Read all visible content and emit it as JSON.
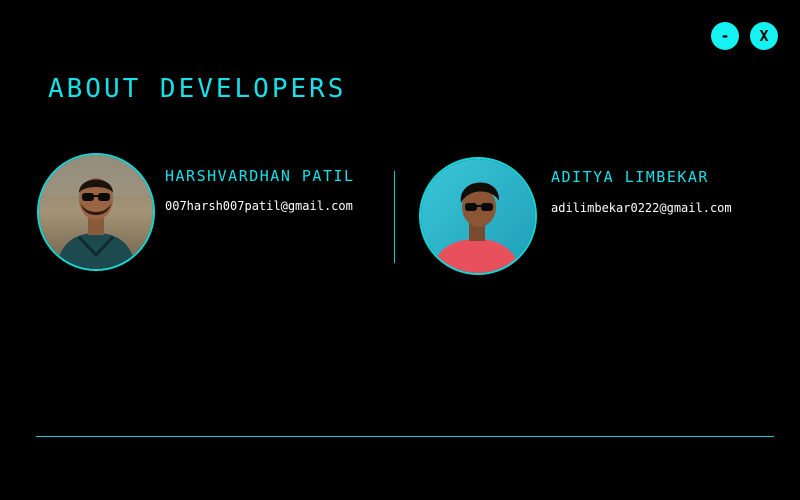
{
  "window": {
    "minimize_label": "-",
    "close_label": "X"
  },
  "page": {
    "title": "ABOUT DEVELOPERS"
  },
  "developers": [
    {
      "name": "HARSHVARDHAN PATIL",
      "email": "007harsh007patil@gmail.com"
    },
    {
      "name": "ADITYA LIMBEKAR",
      "email": "adilimbekar0222@gmail.com"
    }
  ],
  "colors": {
    "background": "#000000",
    "accent": "#16e0e8",
    "button": "#16f2f2",
    "text": "#ffffff"
  }
}
